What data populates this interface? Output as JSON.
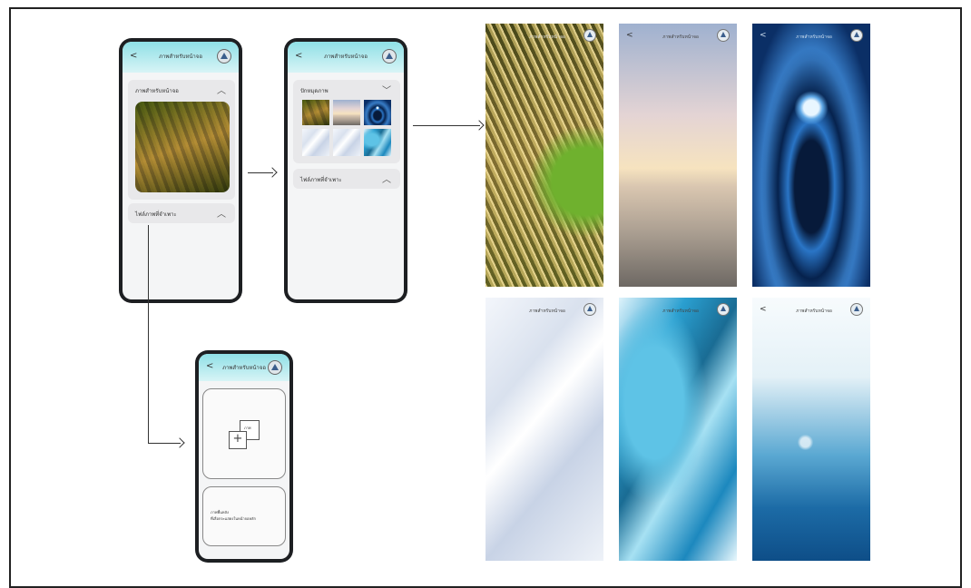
{
  "app": {
    "screen_title": "ภาพสำหรับหน้าจอ",
    "back_glyph": "<"
  },
  "phone1": {
    "panel1_label": "ภาพสำหรับหน้าจอ",
    "panel2_label": "ไฟล์ภาพที่จำเพาะ"
  },
  "phone2": {
    "panel1_label": "ปักหมุดภาพ",
    "panel2_label": "ไฟล์ภาพที่จำเพาะ"
  },
  "phone3": {
    "add_label": "ภาพ",
    "info_text_line1": "ภาพพื้นหลัง",
    "info_text_line2": "ที่เลือกจะแสดงในหน้าจอหลัก"
  },
  "gallery_titles": [
    "ภาพสำหรับหน้าจอ",
    "ภาพสำหรับหน้าจอ",
    "ภาพสำหรับหน้าจอ",
    "ภาพสำหรับหน้าจอ",
    "ภาพสำหรับหน้าจอ",
    "ภาพสำหรับหน้าจอ"
  ],
  "colors": {
    "header_teal": "#8fe0e6",
    "phone_frame": "#1d1f22"
  },
  "icons": [
    "back-icon",
    "logo-icon",
    "chevron-up-icon",
    "chevron-down-icon",
    "add-image-icon"
  ]
}
